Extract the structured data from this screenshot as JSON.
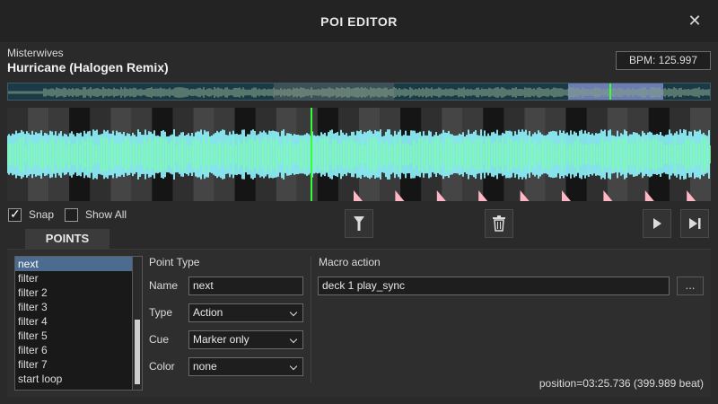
{
  "window": {
    "title": "POI EDITOR",
    "close_label": "✕"
  },
  "track": {
    "artist": "Misterwives",
    "title": "Hurricane (Halogen Remix)",
    "bpm": "BPM: 125.997"
  },
  "controls": {
    "snap_label": "Snap",
    "snap_checked": true,
    "show_all_label": "Show All",
    "show_all_checked": false
  },
  "tab": {
    "label": "POINTS"
  },
  "points_list": {
    "items": [
      "next",
      "filter",
      "filter 2",
      "filter 3",
      "filter 4",
      "filter 5",
      "filter 6",
      "filter 7",
      "start loop"
    ],
    "selected": "next"
  },
  "point_type": {
    "heading": "Point Type",
    "name_label": "Name",
    "name_value": "next",
    "type_label": "Type",
    "type_value": "Action",
    "cue_label": "Cue",
    "cue_value": "Marker only",
    "color_label": "Color",
    "color_value": "none"
  },
  "macro": {
    "heading": "Macro action",
    "value": "deck 1 play_sync",
    "browse_label": "..."
  },
  "status": {
    "position": "position=03:25.736 (399.989 beat)"
  },
  "colors": {
    "wave_green": "#7dffa8",
    "wave_cyan": "#8ff5ff",
    "marker": "#ffb6c6",
    "cursor": "#35ff35",
    "selection": "#4b6b8f"
  },
  "icons": {
    "filter": "filter-icon",
    "delete": "trash-icon",
    "play": "play-icon",
    "next": "skip-next-icon"
  }
}
